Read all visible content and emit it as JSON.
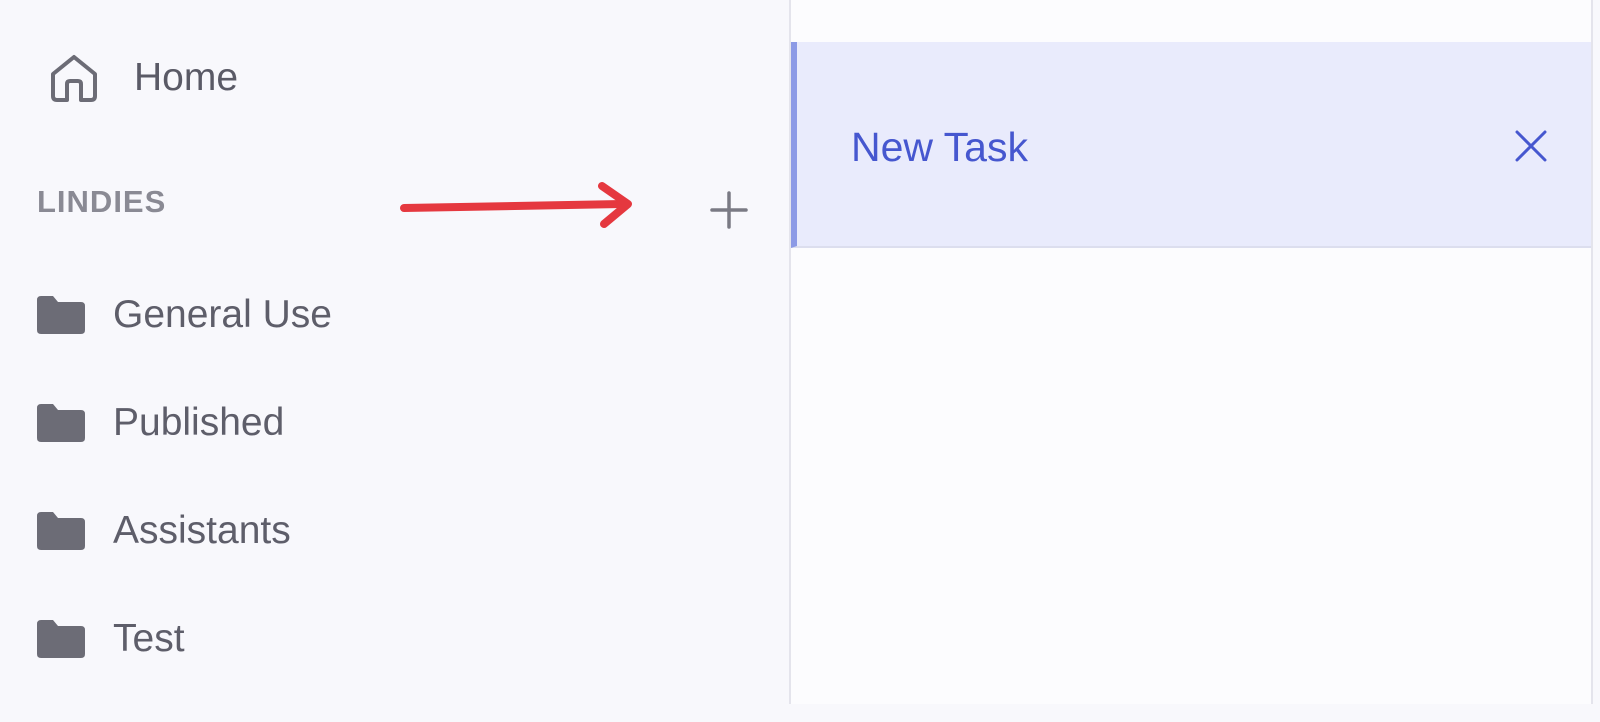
{
  "sidebar": {
    "home": {
      "label": "Home",
      "icon": "home-icon"
    },
    "section": {
      "title": "LINDIES",
      "add_icon": "plus-icon"
    },
    "folders": [
      {
        "label": "General Use",
        "icon": "folder-icon"
      },
      {
        "label": "Published",
        "icon": "folder-icon"
      },
      {
        "label": "Assistants",
        "icon": "folder-icon"
      },
      {
        "label": "Test",
        "icon": "folder-icon"
      }
    ]
  },
  "main": {
    "active_task": {
      "label": "New Task",
      "close_icon": "close-icon"
    }
  },
  "annotation": {
    "type": "arrow",
    "color": "#e5383f"
  },
  "colors": {
    "accent": "#4657cf",
    "selected_bg": "#e9ebfc",
    "selected_border": "#8c9ae6",
    "sidebar_bg": "#f8f8fc",
    "icon_gray": "#6c6c76"
  }
}
